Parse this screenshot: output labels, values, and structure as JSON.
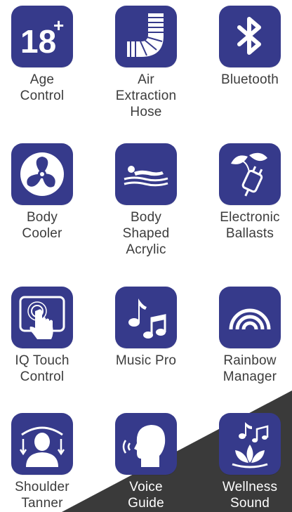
{
  "colors": {
    "tile": "#363a8b",
    "label": "#3c3c3c",
    "dark_corner": "#3a3a3a"
  },
  "features": [
    {
      "id": "age-control",
      "label": "Age\nControl",
      "icon": "eighteen-plus-icon"
    },
    {
      "id": "air-extraction-hose",
      "label": "Air\nExtraction\nHose",
      "icon": "hose-icon"
    },
    {
      "id": "bluetooth",
      "label": "Bluetooth",
      "icon": "bluetooth-icon"
    },
    {
      "id": "body-cooler",
      "label": "Body\nCooler",
      "icon": "fan-icon"
    },
    {
      "id": "body-shaped-acrylic",
      "label": "Body\nShaped\nAcrylic",
      "icon": "reclining-body-icon"
    },
    {
      "id": "electronic-ballasts",
      "label": "Electronic\nBallasts",
      "icon": "eco-plug-icon"
    },
    {
      "id": "iq-touch-control",
      "label": "IQ Touch\nControl",
      "icon": "touch-screen-icon"
    },
    {
      "id": "music-pro",
      "label": "Music Pro",
      "icon": "music-notes-icon"
    },
    {
      "id": "rainbow-manager",
      "label": "Rainbow\nManager",
      "icon": "rainbow-icon"
    },
    {
      "id": "shoulder-tanner",
      "label": "Shoulder\nTanner",
      "icon": "shoulder-person-icon"
    },
    {
      "id": "voice-guide",
      "label": "Voice\nGuide",
      "icon": "speaking-head-icon"
    },
    {
      "id": "wellness-sound",
      "label": "Wellness\nSound",
      "icon": "lotus-music-icon"
    }
  ]
}
